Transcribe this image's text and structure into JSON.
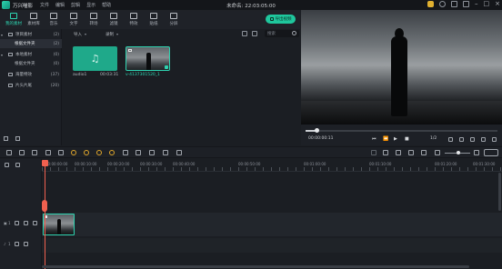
{
  "app": {
    "name": "万兴喵影",
    "title": "未命名: 22:03:05:00",
    "menu": [
      "文件",
      "编辑",
      "剪辑",
      "显示",
      "帮助"
    ]
  },
  "toolbar": {
    "tabs": [
      {
        "label": "我的素材",
        "icon": "folder-icon"
      },
      {
        "label": "素材库",
        "icon": "media-library-icon"
      },
      {
        "label": "音乐",
        "icon": "music-icon"
      },
      {
        "label": "文字",
        "icon": "text-icon"
      },
      {
        "label": "转场",
        "icon": "transition-icon"
      },
      {
        "label": "滤镜",
        "icon": "filter-icon"
      },
      {
        "label": "特效",
        "icon": "effects-icon"
      },
      {
        "label": "贴纸",
        "icon": "sticker-icon"
      },
      {
        "label": "分屏",
        "icon": "split-screen-icon"
      }
    ],
    "export_label": "导出视频"
  },
  "library": {
    "items": [
      {
        "label": "项目素材",
        "count": "(2)"
      },
      {
        "label": "根据文件夹",
        "count": "(2)"
      },
      {
        "label": "本地素材",
        "count": "(0)"
      },
      {
        "label": "根据文件夹",
        "count": "(0)"
      },
      {
        "label": "海量特效",
        "count": "(37)"
      },
      {
        "label": "片头片尾",
        "count": "(20)"
      }
    ]
  },
  "media": {
    "import_label": "导入",
    "record_label": "录制",
    "search_placeholder": "搜索",
    "items": [
      {
        "name": "audio1",
        "duration": "00:03:31"
      },
      {
        "name": "v-4137301520_1"
      }
    ]
  },
  "preview": {
    "timecode": "00:00:00:11",
    "ratio": "1/2",
    "progress": 0.06
  },
  "timeline": {
    "ruler_labels": [
      "00:00:00:00",
      "00:00:10:00",
      "00:00:20:00",
      "00:00:30:00",
      "00:00:40:00",
      "00:00:50:00",
      "00:01:00:00",
      "00:01:10:00",
      "00:01:20:00",
      "00:01:30:00"
    ],
    "video_track": "1",
    "audio_track": "1"
  }
}
